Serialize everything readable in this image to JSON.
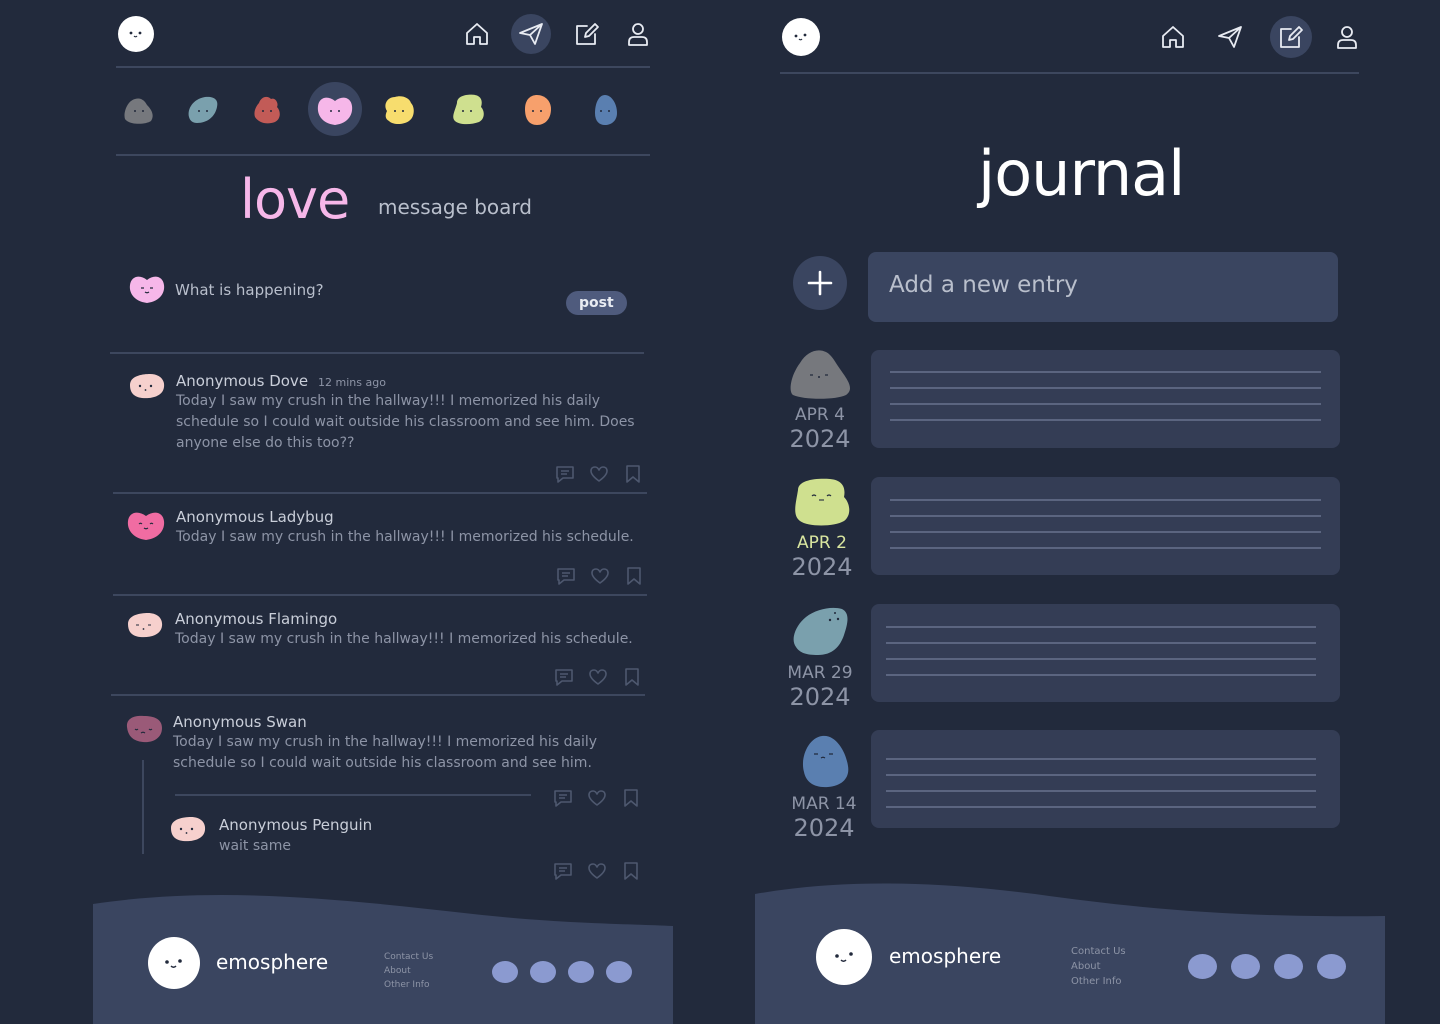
{
  "left": {
    "nav": [
      "home",
      "send",
      "compose",
      "profile"
    ],
    "moods": [
      {
        "name": "gray",
        "color": "#76787d"
      },
      {
        "name": "teal",
        "color": "#7aa0ad"
      },
      {
        "name": "red",
        "color": "#c25b57"
      },
      {
        "name": "pink",
        "color": "#f6b7e9"
      },
      {
        "name": "yellow",
        "color": "#f7dd6e"
      },
      {
        "name": "green",
        "color": "#cfe08f"
      },
      {
        "name": "orange",
        "color": "#f7a06c"
      },
      {
        "name": "blue",
        "color": "#5a7fb0"
      }
    ],
    "board": {
      "title": "love",
      "subtitle": "message board"
    },
    "compose": {
      "placeholder": "What is happening?",
      "post_label": "post"
    },
    "messages": [
      {
        "name": "Anonymous Dove",
        "time": "12 mins ago",
        "text": "Today I saw my crush in the hallway!!! I memorized his daily schedule so I could wait outside his classroom and see him. Does anyone else do this too??",
        "avatar": "#f6d0cd"
      },
      {
        "name": "Anonymous Ladybug",
        "time": "",
        "text": "Today I saw my crush in the hallway!!! I memorized his schedule.",
        "avatar": "#f06ca2"
      },
      {
        "name": "Anonymous Flamingo",
        "time": "",
        "text": "Today I saw my crush in the hallway!!! I memorized his schedule.",
        "avatar": "#f6d0cd"
      },
      {
        "name": "Anonymous Swan",
        "time": "",
        "text": "Today I saw my crush in the hallway!!! I memorized his daily schedule so I could wait outside his classroom and see him.",
        "avatar": "#9a5a78"
      }
    ],
    "reply": {
      "name": "Anonymous Penguin",
      "text": "wait same",
      "avatar": "#f6d0cd"
    }
  },
  "right": {
    "nav": [
      "home",
      "send",
      "compose",
      "profile"
    ],
    "title": "journal",
    "new_entry_placeholder": "Add a new entry",
    "entries": [
      {
        "month_day": "APR 4",
        "year": "2024",
        "mood_color": "#76787d",
        "highlight": false
      },
      {
        "month_day": "APR 2",
        "year": "2024",
        "mood_color": "#cfe08f",
        "highlight": true
      },
      {
        "month_day": "MAR 29",
        "year": "2024",
        "mood_color": "#7aa0ad",
        "highlight": false
      },
      {
        "month_day": "MAR 14",
        "year": "2024",
        "mood_color": "#5a7fb0",
        "highlight": false
      }
    ]
  },
  "footer": {
    "brand": "emosphere",
    "links": [
      "Contact Us",
      "About",
      "Other Info"
    ]
  }
}
